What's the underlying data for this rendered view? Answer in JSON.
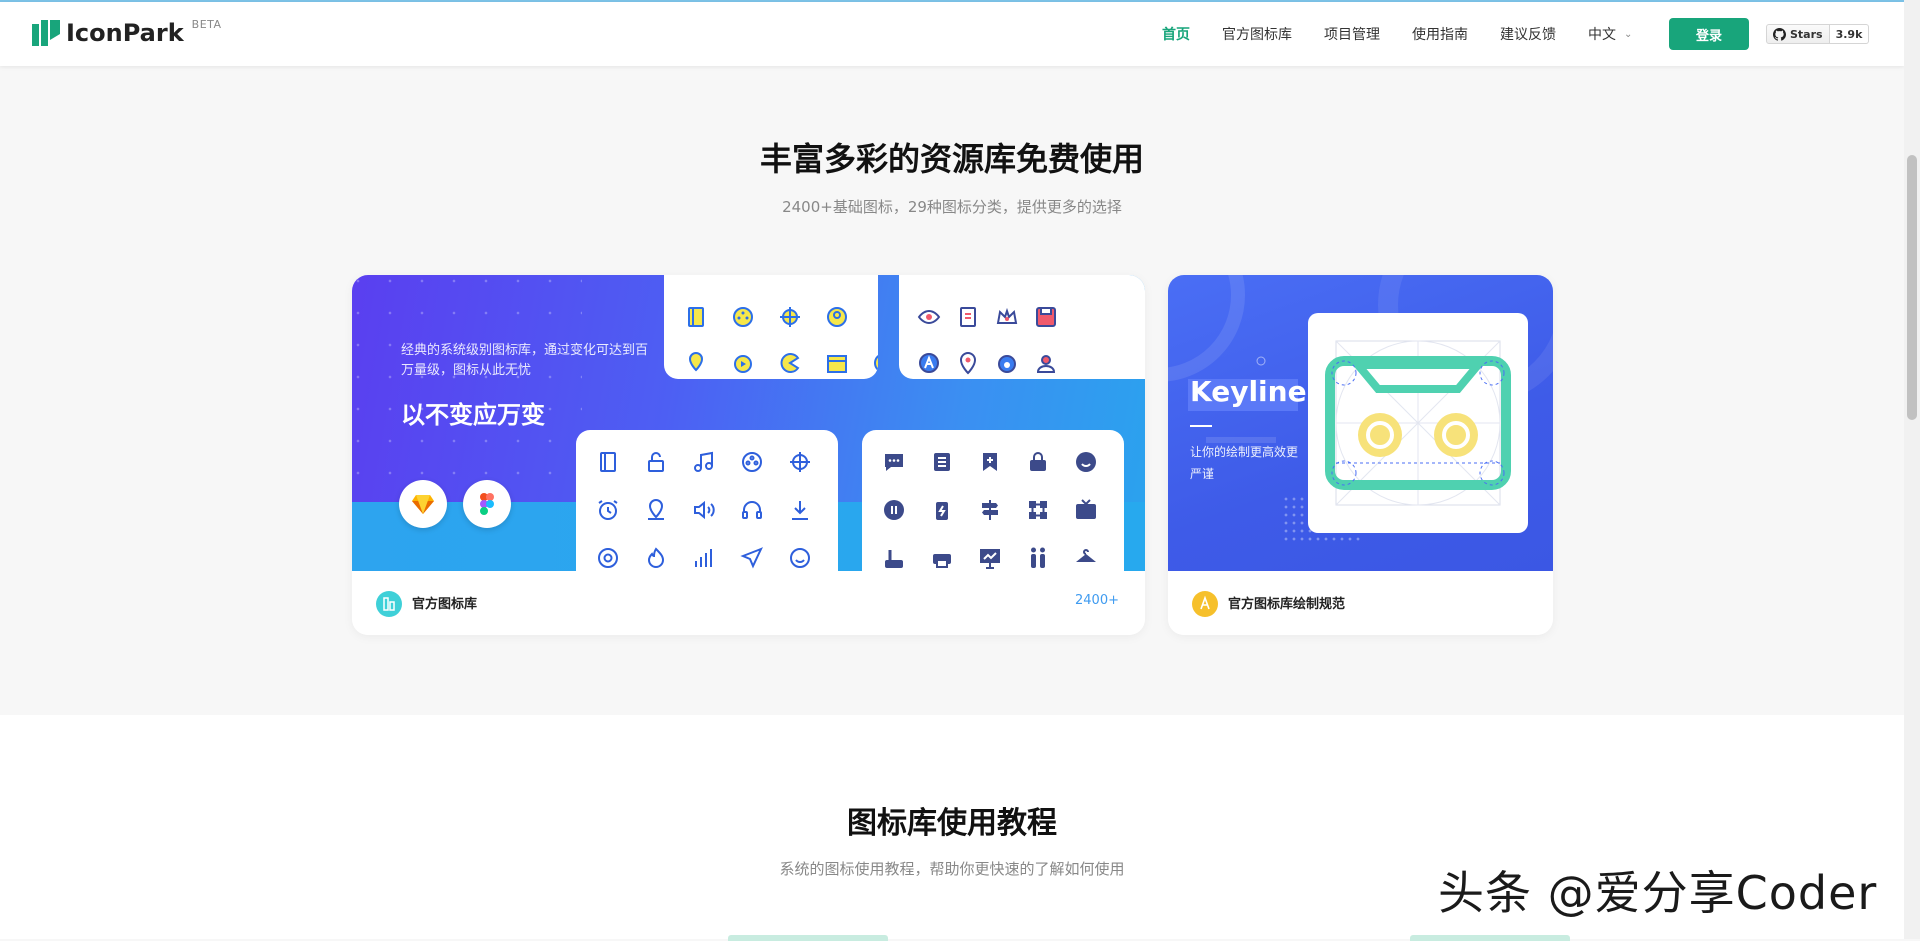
{
  "header": {
    "logo_text": "IconPark",
    "logo_badge": "BETA",
    "nav": [
      "首页",
      "官方图标库",
      "项目管理",
      "使用指南",
      "建议反馈"
    ],
    "language": "中文",
    "login_label": "登录",
    "github": {
      "label": "Stars",
      "count": "3.9k"
    }
  },
  "section1": {
    "title": "丰富多彩的资源库免费使用",
    "subtitle": "2400+基础图标，29种图标分类，提供更多的选择",
    "card1": {
      "desc": "经典的系统级别图标库，通过变化可达到百万量级，图标从此无忧",
      "headline": "以不变应万变",
      "footer_label": "官方图标库",
      "footer_count": "2400+"
    },
    "card2": {
      "title": "Keyline",
      "desc": "让你的绘制更高效更严谨",
      "footer_label": "官方图标库绘制规范"
    }
  },
  "section2": {
    "title": "图标库使用教程",
    "subtitle": "系统的图标使用教程，帮助你更快速的了解如何使用"
  },
  "watermark": "头条 @爱分享Coder",
  "colors": {
    "brand": "#18a57b",
    "accent_blue": "#3f9bf0",
    "yellow": "#f6c02b",
    "keyline_green": "#4fd1b0"
  }
}
